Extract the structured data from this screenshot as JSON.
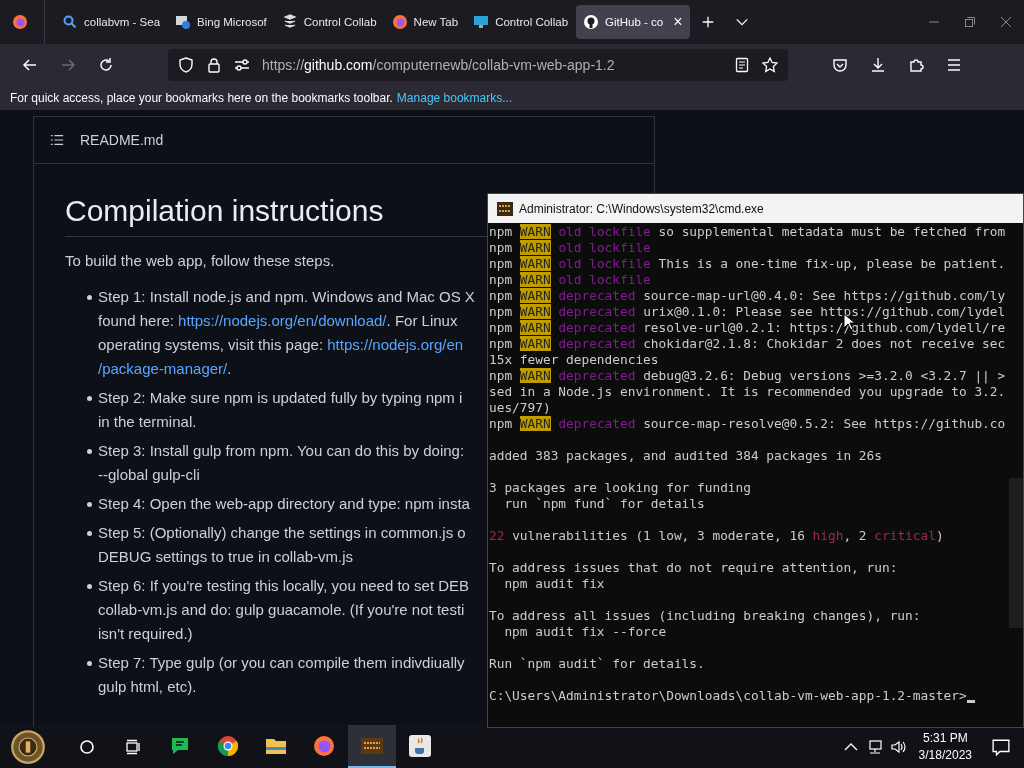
{
  "browser": {
    "tabs": [
      {
        "kind": "search",
        "label": "collabvm - Sea",
        "selected": false
      },
      {
        "kind": "bing",
        "label": "Bing Microsof",
        "selected": false
      },
      {
        "kind": "server",
        "label": "Control Collab",
        "selected": false
      },
      {
        "kind": "firefox",
        "label": "New Tab",
        "selected": false
      },
      {
        "kind": "monitor",
        "label": "Control Collab",
        "selected": false
      },
      {
        "kind": "github",
        "label": "GitHub - co",
        "selected": true
      }
    ],
    "close_tab": "×",
    "url": "https://**github.com**/computernewb/collab-vm-web-app-1.2",
    "bookmarks_hint": "For quick access, place your bookmarks here on the bookmarks toolbar.",
    "bookmarks_link": "Manage bookmarks..."
  },
  "readme": {
    "file": "README.md",
    "heading": "Compilation instructions",
    "intro": "To build the web app, follow these steps.",
    "steps": [
      {
        "lines": [
          [
            {
              "text": "Step 1: Install node.js and npm. Windows and Mac OS X",
              "link": false
            }
          ],
          [
            {
              "text": "found here: ",
              "link": false
            },
            {
              "text": "https://nodejs.org/en/download/",
              "link": true
            },
            {
              "text": ". For Linux",
              "link": false
            }
          ],
          [
            {
              "text": "operating systems, visit this page: ",
              "link": false
            },
            {
              "text": "https://nodejs.org/en",
              "link": true
            }
          ],
          [
            {
              "text": "/package-manager/",
              "link": true
            },
            {
              "text": ".",
              "link": false
            }
          ]
        ]
      },
      {
        "lines": [
          [
            {
              "text": "Step 2: Make sure npm is updated fully by typing npm i",
              "link": false
            }
          ],
          [
            {
              "text": "in the terminal.",
              "link": false
            }
          ]
        ]
      },
      {
        "lines": [
          [
            {
              "text": "Step 3: Install gulp from npm. You can do this by doing:",
              "link": false
            }
          ],
          [
            {
              "text": "--global gulp-cli",
              "link": false
            }
          ]
        ]
      },
      {
        "lines": [
          [
            {
              "text": "Step 4: Open the web-app directory and type: npm insta",
              "link": false
            }
          ]
        ]
      },
      {
        "lines": [
          [
            {
              "text": "Step 5: (Optionally) change the settings in common.js o",
              "link": false
            }
          ],
          [
            {
              "text": "DEBUG settings to true in collab-vm.js",
              "link": false
            }
          ]
        ]
      },
      {
        "lines": [
          [
            {
              "text": "Step 6: If you're testing this locally, you need to set DEB",
              "link": false
            }
          ],
          [
            {
              "text": "collab-vm.js and do: gulp guacamole. (If you're not testi",
              "link": false
            }
          ],
          [
            {
              "text": "isn't required.)",
              "link": false
            }
          ]
        ]
      },
      {
        "lines": [
          [
            {
              "text": "Step 7: Type gulp (or you can compile them indivdiually",
              "link": false
            }
          ],
          [
            {
              "text": "gulp html, etc).",
              "link": false
            }
          ]
        ]
      }
    ]
  },
  "terminal": {
    "title": "Administrator: C:\\Windows\\system32\\cmd.exe",
    "lines": [
      {
        "kind": "warn",
        "program": "npm",
        "tag": "WARN",
        "category": "old lockfile",
        "message": "so supplemental metadata must be fetched from"
      },
      {
        "kind": "warn",
        "program": "npm",
        "tag": "WARN",
        "category": "old lockfile"
      },
      {
        "kind": "warn",
        "program": "npm",
        "tag": "WARN",
        "category": "old lockfile",
        "message": "This is a one-time fix-up, please be patient."
      },
      {
        "kind": "warn",
        "program": "npm",
        "tag": "WARN",
        "category": "old lockfile"
      },
      {
        "kind": "warn",
        "program": "npm",
        "tag": "WARN",
        "category": "deprecated",
        "message": "source-map-url@0.4.0: See https://github.com/ly"
      },
      {
        "kind": "warn",
        "program": "npm",
        "tag": "WARN",
        "category": "deprecated",
        "message": "urix@0.1.0: Please see https://github.com/lydel"
      },
      {
        "kind": "warn",
        "program": "npm",
        "tag": "WARN",
        "category": "deprecated",
        "message": "resolve-url@0.2.1: https://github.com/lydell/re"
      },
      {
        "kind": "warn",
        "program": "npm",
        "tag": "WARN",
        "category": "deprecated",
        "message": "chokidar@2.1.8: Chokidar 2 does not receive sec"
      },
      {
        "kind": "text",
        "text": "15x fewer dependencies"
      },
      {
        "kind": "warn",
        "program": "npm",
        "tag": "WARN",
        "category": "deprecated",
        "message": "debug@3.2.6: Debug versions >=3.2.0 <3.2.7 || >"
      },
      {
        "kind": "text",
        "text": "sed in a Node.js environment. It is recommended you upgrade to 3.2."
      },
      {
        "kind": "text",
        "text": "ues/797)"
      },
      {
        "kind": "warn",
        "program": "npm",
        "tag": "WARN",
        "category": "deprecated",
        "message": "source-map-resolve@0.5.2: See https://github.co"
      },
      {
        "kind": "blank"
      },
      {
        "kind": "text",
        "text": "added 383 packages, and audited 384 packages in 26s"
      },
      {
        "kind": "blank"
      },
      {
        "kind": "text",
        "text": "3 packages are looking for funding"
      },
      {
        "kind": "text",
        "text": "  run `npm fund` for details"
      },
      {
        "kind": "blank"
      },
      {
        "kind": "audit",
        "segments": [
          {
            "text": "22",
            "highlight": true
          },
          {
            "text": " vulnerabilities (1 low, 3 moderate, 16 ",
            "highlight": false
          },
          {
            "text": "high",
            "highlight": true
          },
          {
            "text": ", 2 ",
            "highlight": false
          },
          {
            "text": "critical",
            "highlight": true
          },
          {
            "text": ")",
            "highlight": false
          }
        ]
      },
      {
        "kind": "blank"
      },
      {
        "kind": "text",
        "text": "To address issues that do not require attention, run:"
      },
      {
        "kind": "text",
        "text": "  npm audit fix"
      },
      {
        "kind": "blank"
      },
      {
        "kind": "text",
        "text": "To address all issues (including breaking changes), run:"
      },
      {
        "kind": "text",
        "text": "  npm audit fix --force"
      },
      {
        "kind": "blank"
      },
      {
        "kind": "text",
        "text": "Run `npm audit` for details."
      },
      {
        "kind": "blank"
      },
      {
        "kind": "prompt",
        "text": "C:\\Users\\Administrator\\Downloads\\collab-vm-web-app-1.2-master>"
      }
    ]
  },
  "taskbar": {
    "apps": [
      {
        "kind": "chat",
        "selected": false
      },
      {
        "kind": "chrome",
        "selected": false
      },
      {
        "kind": "folder",
        "selected": false
      },
      {
        "kind": "firefox",
        "selected": false
      },
      {
        "kind": "emulator",
        "selected": true
      },
      {
        "kind": "java",
        "selected": false
      }
    ],
    "time": "5:31 PM",
    "date": "3/18/2023"
  }
}
